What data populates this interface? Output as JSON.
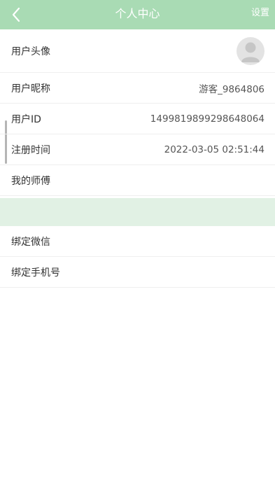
{
  "header": {
    "title": "个人中心",
    "settings_label": "设置",
    "bg_color": "#a9dbb4",
    "back_icon": "chevron-left-icon"
  },
  "profile": {
    "avatar_label": "用户头像",
    "nickname_label": "用户昵称",
    "nickname_value": "游客_9864806",
    "userid_label": "用户ID",
    "userid_value": "1499819899298648064",
    "register_label": "注册时间",
    "register_value": "2022-03-05 02:51:44",
    "master_label": "我的师傅"
  },
  "binding": {
    "wechat_label": "绑定微信",
    "phone_label": "绑定手机号"
  }
}
